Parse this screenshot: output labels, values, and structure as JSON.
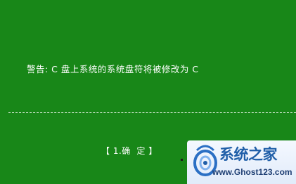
{
  "dialog": {
    "warning_text": "警告: C 盘上系统的系统盘符将被修改为 C",
    "confirm_button": "【 1.确  定 】"
  },
  "watermark": {
    "title": "系统之家",
    "url": "www.Ghost123.com",
    "icon": "ghost-logo-icon"
  },
  "colors": {
    "background": "#188718",
    "text": "#ffffff",
    "watermark_blue": "#1f5ea8"
  }
}
